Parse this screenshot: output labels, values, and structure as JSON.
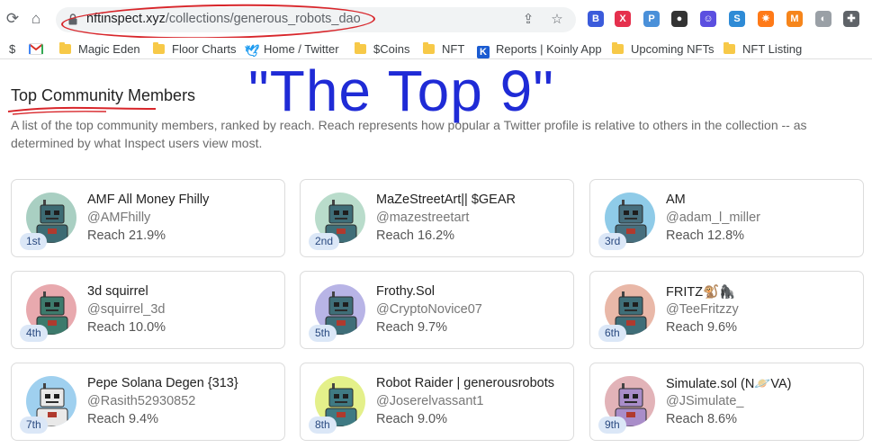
{
  "browser": {
    "url_host": "nftinspect.xyz",
    "url_path": "/collections/generous_robots_dao",
    "extensions": [
      {
        "icon": "bank-extension-icon",
        "color": "#3b5bdb",
        "glyph": "B"
      },
      {
        "icon": "x-extension-icon",
        "color": "#e5304d",
        "glyph": "X"
      },
      {
        "icon": "puzzle-extension-icon",
        "color": "#4a90d9",
        "glyph": "P"
      },
      {
        "icon": "dark-circle-extension-icon",
        "color": "#333333",
        "glyph": "●"
      },
      {
        "icon": "smile-extension-icon",
        "color": "#5b4fe0",
        "glyph": "☺"
      },
      {
        "icon": "s-extension-icon",
        "color": "#2e8bd6",
        "glyph": "S"
      },
      {
        "icon": "spark-extension-icon",
        "color": "#ff7a18",
        "glyph": "✷"
      },
      {
        "icon": "metamask-fox-icon",
        "color": "#f6851b",
        "glyph": "M"
      },
      {
        "icon": "toggle-extension-icon",
        "color": "#9aa0a6",
        "glyph": "◐"
      },
      {
        "icon": "extensions-puzzle-icon",
        "color": "#5f6368",
        "glyph": "✚"
      }
    ]
  },
  "bookmarks": [
    {
      "label": "$",
      "icon": "dollar-icon"
    },
    {
      "label": "",
      "icon": "gmail-icon"
    },
    {
      "label": "Magic Eden",
      "icon": "folder-icon"
    },
    {
      "label": "Floor Charts",
      "icon": "folder-icon"
    },
    {
      "label": "Home / Twitter",
      "icon": "twitter-icon"
    },
    {
      "label": "$Coins",
      "icon": "folder-icon"
    },
    {
      "label": "NFT",
      "icon": "folder-icon"
    },
    {
      "label": "Reports | Koinly App",
      "icon": "koinly-icon"
    },
    {
      "label": "Upcoming NFTs",
      "icon": "folder-icon"
    },
    {
      "label": "NFT Listing",
      "icon": "folder-icon"
    }
  ],
  "page": {
    "title": "Top Community Members",
    "annotation": "\"The Top 9\"",
    "description": "A list of the top community members, ranked by reach. Reach represents how popular a Twitter profile is relative to others in the collection -- as determined by what Inspect users view most."
  },
  "members": [
    {
      "rank": "1st",
      "name": "AMF All Money Fhilly",
      "handle": "@AMFhilly",
      "reach": "Reach 21.9%",
      "bg": "#a9cfc2",
      "robot": "#3d6b73"
    },
    {
      "rank": "2nd",
      "name": "MaZeStreetArt|| $GEAR",
      "handle": "@mazestreetart",
      "reach": "Reach 16.2%",
      "bg": "#b9dccb",
      "robot": "#3f6e78"
    },
    {
      "rank": "3rd",
      "name": "AM",
      "handle": "@adam_l_miller",
      "reach": "Reach 12.8%",
      "bg": "#8fcbe8",
      "robot": "#476f7e"
    },
    {
      "rank": "4th",
      "name": "3d squirrel",
      "handle": "@squirrel_3d",
      "reach": "Reach 10.0%",
      "bg": "#e8a9ae",
      "robot": "#3d7a6c"
    },
    {
      "rank": "5th",
      "name": "Frothy.Sol",
      "handle": "@CryptoNovice07",
      "reach": "Reach 9.7%",
      "bg": "#b8b4e6",
      "robot": "#3f6e78"
    },
    {
      "rank": "6th",
      "name": "FRITZ🐒🦍",
      "handle": "@TeeFritzzy",
      "reach": "Reach 9.6%",
      "bg": "#e9b8a8",
      "robot": "#3f6e78"
    },
    {
      "rank": "7th",
      "name": "Pepe Solana Degen {313}",
      "handle": "@Rasith52930852",
      "reach": "Reach 9.4%",
      "bg": "#9fd0ef",
      "robot": "#e9e9e9"
    },
    {
      "rank": "8th",
      "name": "Robot Raider | generousrobots",
      "handle": "@Joserelvassant1",
      "reach": "Reach 9.0%",
      "bg": "#e4f08a",
      "robot": "#3f7a83"
    },
    {
      "rank": "9th",
      "name": "Simulate.sol (N🪐VA)",
      "handle": "@JSimulate_",
      "reach": "Reach 8.6%",
      "bg": "#e2b3b8",
      "robot": "#a98dc9"
    }
  ]
}
